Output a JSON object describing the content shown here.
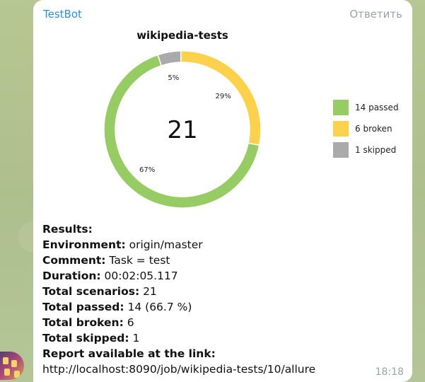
{
  "message": {
    "sender": "TestBot",
    "reply_label": "Ответить",
    "time": "18:18"
  },
  "chart_data": {
    "type": "pie",
    "title": "wikipedia-tests",
    "center_label": "21",
    "slices": [
      {
        "label": "passed",
        "value": 14,
        "percent_label": "67%",
        "color": "#97cc64"
      },
      {
        "label": "broken",
        "value": 6,
        "percent_label": "29%",
        "color": "#fed14c"
      },
      {
        "label": "skipped",
        "value": 1,
        "percent_label": "5%",
        "color": "#aaaaaa"
      }
    ],
    "legend": [
      "14 passed",
      "6 broken",
      "1 skipped"
    ],
    "legend_position": "right"
  },
  "results": {
    "heading": "Results:",
    "rows": [
      {
        "key": "Environment:",
        "value": "origin/master"
      },
      {
        "key": "Comment:",
        "value": "Task = test"
      },
      {
        "key": "Duration:",
        "value": "00:02:05.117"
      },
      {
        "key": "Total scenarios:",
        "value": "21"
      },
      {
        "key": "Total passed:",
        "value": "14 (66.7 %)"
      },
      {
        "key": "Total broken:",
        "value": "6"
      },
      {
        "key": "Total skipped:",
        "value": "1"
      }
    ],
    "report_key": "Report available at the link:",
    "report_link": "http://localhost:8090/job/wikipedia-tests/10/allure"
  }
}
